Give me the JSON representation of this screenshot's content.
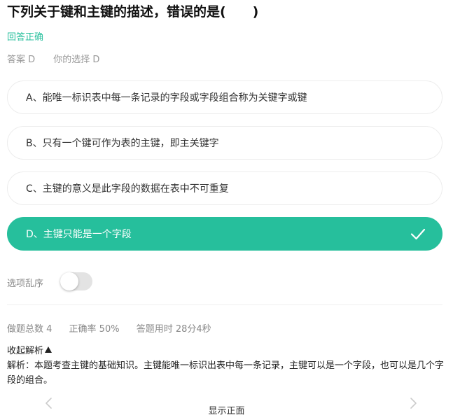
{
  "question": {
    "title": "下列关于键和主键的描述，错误的是(　　)"
  },
  "result_text": "回答正确",
  "answer": {
    "correct_label": "答案 D",
    "choice_label": "你的选择 D"
  },
  "options": [
    {
      "label": "A、能唯一标识表中每一条记录的字段或字段组合称为关键字或键",
      "selected": false
    },
    {
      "label": "B、只有一个键可作为表的主键，即主关键字",
      "selected": false
    },
    {
      "label": "C、主键的意义是此字段的数据在表中不可重复",
      "selected": false
    },
    {
      "label": "D、主键只能是一个字段",
      "selected": true
    }
  ],
  "shuffle": {
    "label": "选项乱序",
    "enabled": false
  },
  "stats": {
    "total": "做题总数 4",
    "accuracy": "正确率 50%",
    "time": "答题用时 28分4秒"
  },
  "analysis": {
    "toggle_label": "收起解析",
    "text": "解析：本题考查主键的基础知识。主键能唯一标识出表中每一条记录，主键可以是一个字段，也可以是几个字段的组合。"
  },
  "bottom": {
    "show_front_label": "显示正面"
  },
  "colors": {
    "accent": "#26bf9c",
    "muted": "#999999"
  },
  "icons": {
    "check": "check-icon",
    "prev": "chevron-left-icon",
    "next": "chevron-right-icon",
    "collapse": "triangle-up-icon"
  }
}
